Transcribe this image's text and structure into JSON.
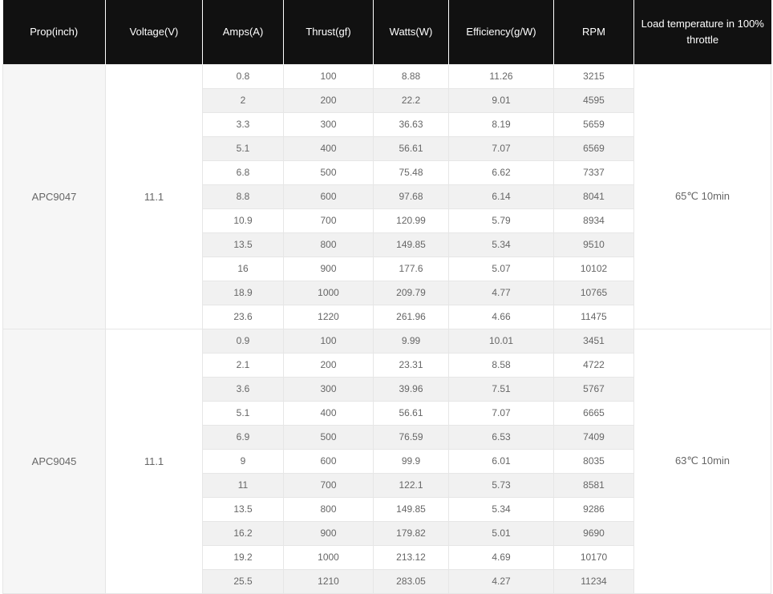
{
  "headers": [
    "Prop(inch)",
    "Voltage(V)",
    "Amps(A)",
    "Thrust(gf)",
    "Watts(W)",
    "Efficiency(g/W)",
    "RPM",
    "Load temperature in 100% throttle"
  ],
  "groups": [
    {
      "prop": "APC9047",
      "voltage": "11.1",
      "temperature": "65℃ 10min",
      "rows": [
        [
          "0.8",
          "100",
          "8.88",
          "11.26",
          "3215"
        ],
        [
          "2",
          "200",
          "22.2",
          "9.01",
          "4595"
        ],
        [
          "3.3",
          "300",
          "36.63",
          "8.19",
          "5659"
        ],
        [
          "5.1",
          "400",
          "56.61",
          "7.07",
          "6569"
        ],
        [
          "6.8",
          "500",
          "75.48",
          "6.62",
          "7337"
        ],
        [
          "8.8",
          "600",
          "97.68",
          "6.14",
          "8041"
        ],
        [
          "10.9",
          "700",
          "120.99",
          "5.79",
          "8934"
        ],
        [
          "13.5",
          "800",
          "149.85",
          "5.34",
          "9510"
        ],
        [
          "16",
          "900",
          "177.6",
          "5.07",
          "10102"
        ],
        [
          "18.9",
          "1000",
          "209.79",
          "4.77",
          "10765"
        ],
        [
          "23.6",
          "1220",
          "261.96",
          "4.66",
          "11475"
        ]
      ]
    },
    {
      "prop": "APC9045",
      "voltage": "11.1",
      "temperature": "63℃ 10min",
      "rows": [
        [
          "0.9",
          "100",
          "9.99",
          "10.01",
          "3451"
        ],
        [
          "2.1",
          "200",
          "23.31",
          "8.58",
          "4722"
        ],
        [
          "3.6",
          "300",
          "39.96",
          "7.51",
          "5767"
        ],
        [
          "5.1",
          "400",
          "56.61",
          "7.07",
          "6665"
        ],
        [
          "6.9",
          "500",
          "76.59",
          "6.53",
          "7409"
        ],
        [
          "9",
          "600",
          "99.9",
          "6.01",
          "8035"
        ],
        [
          "11",
          "700",
          "122.1",
          "5.73",
          "8581"
        ],
        [
          "13.5",
          "800",
          "149.85",
          "5.34",
          "9286"
        ],
        [
          "16.2",
          "900",
          "179.82",
          "5.01",
          "9690"
        ],
        [
          "19.2",
          "1000",
          "213.12",
          "4.69",
          "10170"
        ],
        [
          "25.5",
          "1210",
          "283.05",
          "4.27",
          "11234"
        ]
      ]
    }
  ]
}
